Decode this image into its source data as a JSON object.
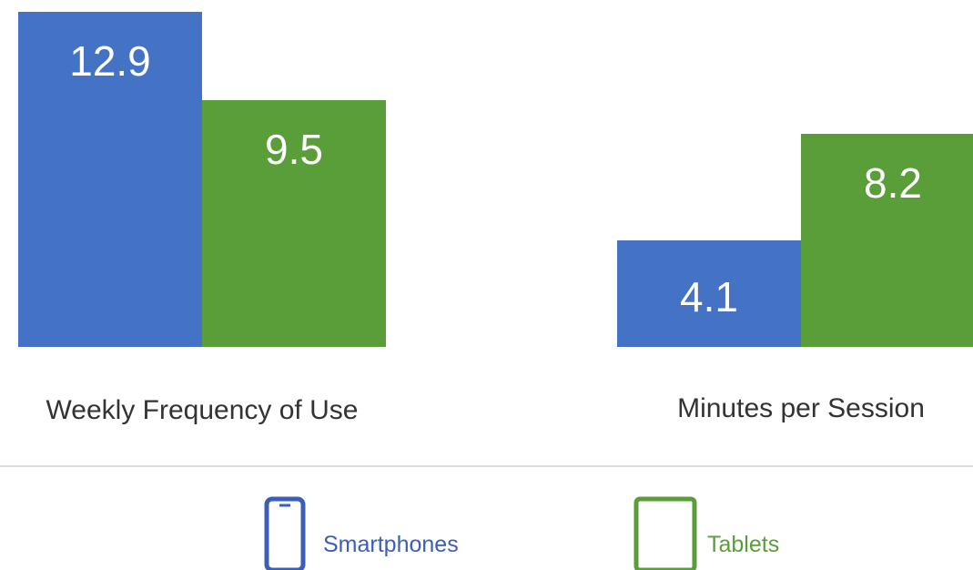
{
  "chart_data": {
    "type": "bar",
    "categories": [
      "Weekly Frequency of Use",
      "Minutes per Session"
    ],
    "series": [
      {
        "name": "Smartphones",
        "values": [
          12.9,
          4.1
        ],
        "color": "#4472c4",
        "icon": "smartphone-icon"
      },
      {
        "name": "Tablets",
        "values": [
          9.5,
          8.2
        ],
        "color": "#5a9e3a",
        "icon": "tablet-icon"
      }
    ],
    "value_labels": [
      [
        "12.9",
        "4.1"
      ],
      [
        "9.5",
        "8.2"
      ]
    ],
    "grid": false,
    "legend_position": "bottom-center",
    "per_group_scale": true
  },
  "legend_colors": {
    "Smartphones": "#3b5fb8",
    "Tablets": "#5a9e3a"
  }
}
